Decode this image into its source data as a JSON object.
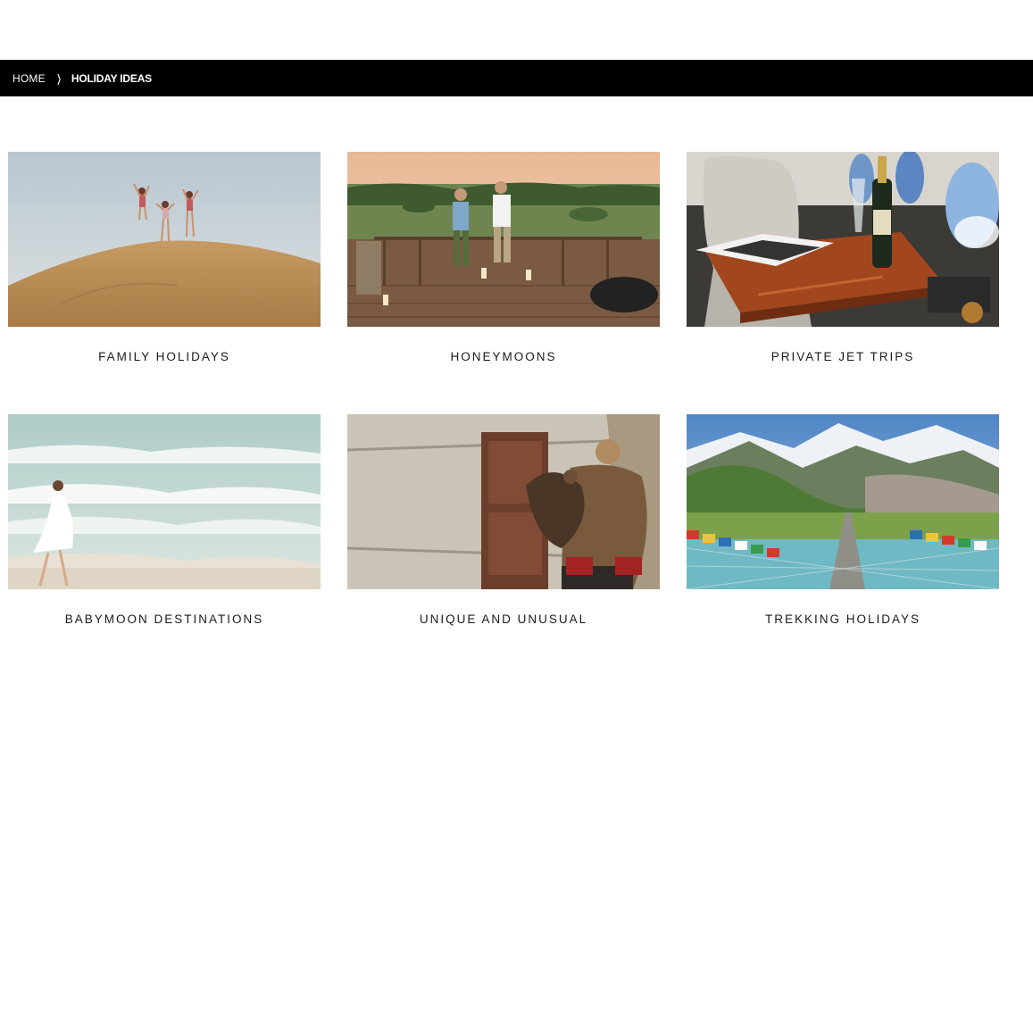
{
  "breadcrumb": {
    "home_label": "HOME",
    "separator": "❭",
    "current_label": "HOLIDAY IDEAS"
  },
  "cards": [
    {
      "label": "FAMILY HOLIDAYS",
      "image": "desert-dune-family-jumping"
    },
    {
      "label": "HONEYMOONS",
      "image": "safari-deck-couple-toast"
    },
    {
      "label": "PRIVATE JET TRIPS",
      "image": "jet-cabin-champagne"
    },
    {
      "label": "BABYMOON DESTINATIONS",
      "image": "beach-pregnant-woman-waves"
    },
    {
      "label": "UNIQUE AND UNUSUAL",
      "image": "yurt-eagle-hunter"
    },
    {
      "label": "TREKKING HOLIDAYS",
      "image": "mountain-suspension-bridge-prayer-flags"
    }
  ]
}
